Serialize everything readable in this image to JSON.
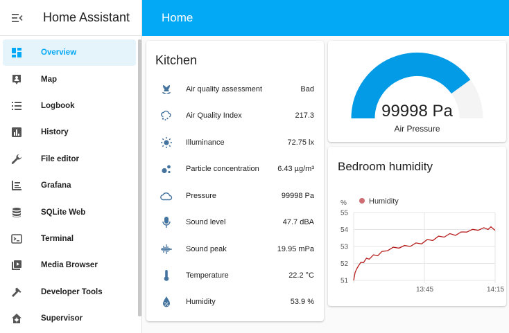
{
  "app": {
    "title": "Home Assistant"
  },
  "header": {
    "title": "Home"
  },
  "sidebar": {
    "items": [
      {
        "label": "Overview",
        "icon": "overview-icon",
        "active": true
      },
      {
        "label": "Map",
        "icon": "map-icon"
      },
      {
        "label": "Logbook",
        "icon": "logbook-icon"
      },
      {
        "label": "History",
        "icon": "history-icon"
      },
      {
        "label": "File editor",
        "icon": "wrench-icon"
      },
      {
        "label": "Grafana",
        "icon": "grafana-icon"
      },
      {
        "label": "SQLite Web",
        "icon": "database-icon"
      },
      {
        "label": "Terminal",
        "icon": "terminal-icon"
      },
      {
        "label": "Media Browser",
        "icon": "media-browser-icon"
      },
      {
        "label": "Developer Tools",
        "icon": "hammer-icon"
      },
      {
        "label": "Supervisor",
        "icon": "supervisor-icon"
      }
    ]
  },
  "kitchen": {
    "title": "Kitchen",
    "entities": [
      {
        "name": "Air quality assessment",
        "value": "Bad",
        "icon": "flower-icon"
      },
      {
        "name": "Air Quality Index",
        "value": "217.3",
        "icon": "weather-cloudy-icon"
      },
      {
        "name": "Illuminance",
        "value": "72.75 lx",
        "icon": "brightness-icon"
      },
      {
        "name": "Particle concentration",
        "value": "6.43 µg/m³",
        "icon": "particles-icon"
      },
      {
        "name": "Pressure",
        "value": "99998 Pa",
        "icon": "cloud-icon"
      },
      {
        "name": "Sound level",
        "value": "47.7 dBA",
        "icon": "microphone-icon"
      },
      {
        "name": "Sound peak",
        "value": "19.95 mPa",
        "icon": "waveform-icon"
      },
      {
        "name": "Temperature",
        "value": "22.2 °C",
        "icon": "thermometer-icon"
      },
      {
        "name": "Humidity",
        "value": "53.9 %",
        "icon": "water-percent-icon"
      }
    ]
  },
  "gauge": {
    "value_text": "99998 Pa",
    "name": "Air Pressure",
    "fraction": 0.8,
    "color": "#039be5",
    "track_color": "#f4f4f4"
  },
  "humidity_card": {
    "title": "Bedroom humidity"
  },
  "colors": {
    "accent": "#03a9f4",
    "icon": "#44739e",
    "series": "#b71c1c"
  },
  "chart_data": {
    "type": "line",
    "title": "",
    "ylabel": "%",
    "ylim": [
      51,
      55
    ],
    "yticks": [
      "51",
      "52",
      "53",
      "54",
      "55"
    ],
    "xticks": [
      {
        "label": "13:45",
        "x": 0.5
      },
      {
        "label": "14:15",
        "x": 1.0
      }
    ],
    "grid": true,
    "legend": "top-left",
    "series": [
      {
        "name": "Humidity",
        "x": [
          0,
          0.01,
          0.02,
          0.03,
          0.05,
          0.07,
          0.09,
          0.11,
          0.14,
          0.17,
          0.2,
          0.24,
          0.28,
          0.32,
          0.36,
          0.4,
          0.44,
          0.48,
          0.52,
          0.56,
          0.6,
          0.64,
          0.68,
          0.72,
          0.76,
          0.8,
          0.84,
          0.88,
          0.92,
          0.95,
          0.97,
          1.0
        ],
        "values": [
          51.0,
          51.5,
          51.6,
          51.85,
          52.0,
          52.1,
          52.25,
          52.3,
          52.45,
          52.5,
          52.65,
          52.8,
          52.9,
          52.95,
          53.0,
          53.05,
          53.15,
          53.2,
          53.35,
          53.4,
          53.55,
          53.6,
          53.7,
          53.7,
          53.8,
          53.9,
          53.95,
          54.0,
          54.05,
          54.05,
          54.1,
          53.95
        ]
      }
    ]
  }
}
